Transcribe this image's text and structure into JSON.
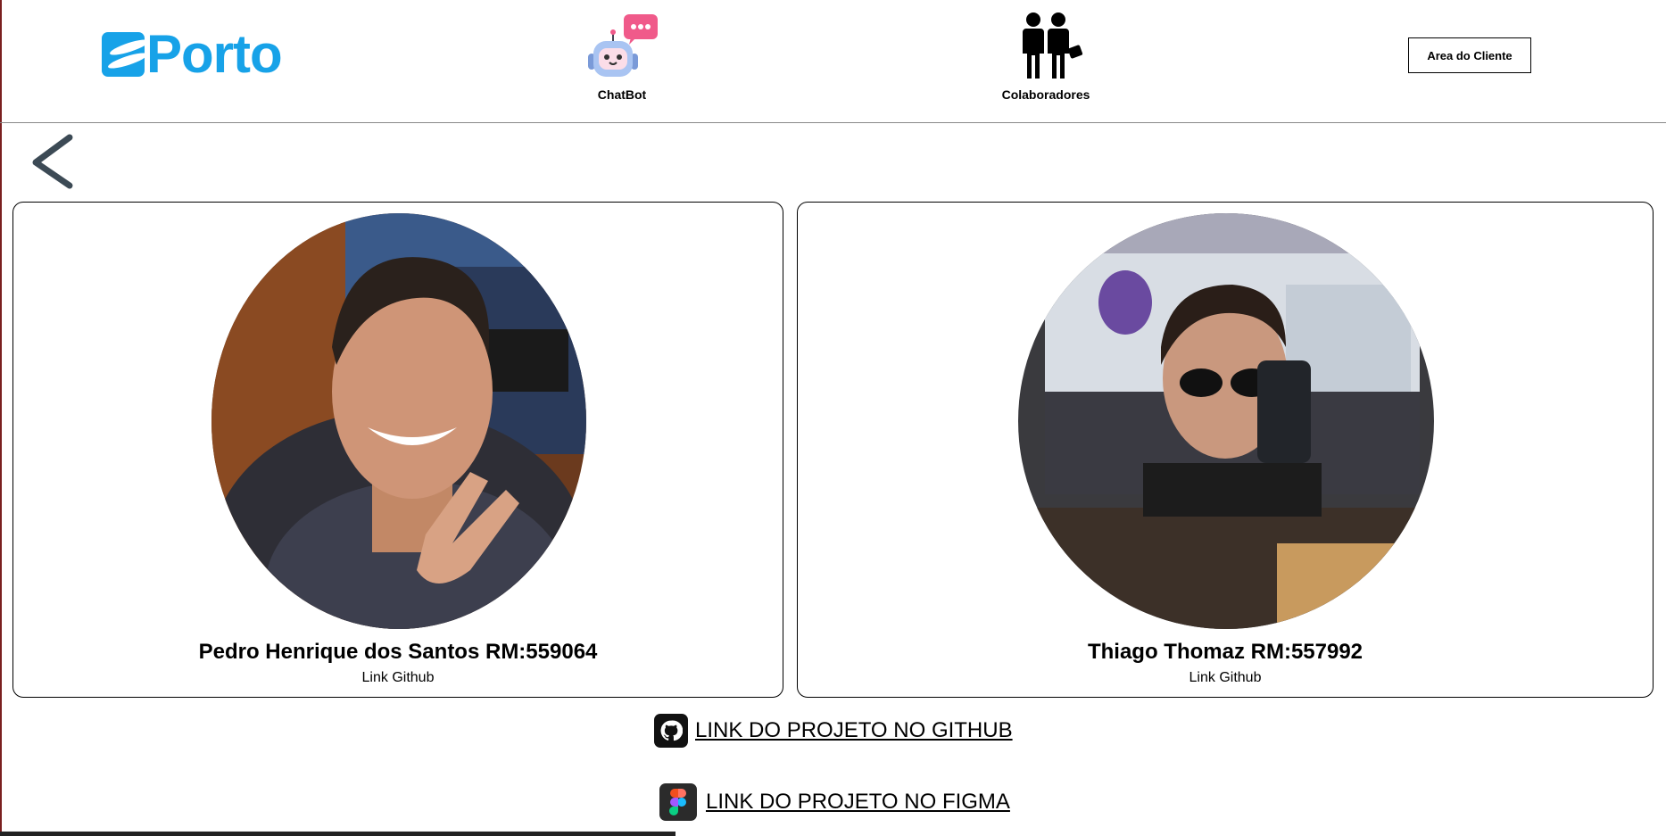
{
  "header": {
    "logo_text": "Porto",
    "nav": [
      {
        "label": "ChatBot",
        "icon": "robot-chat-icon"
      },
      {
        "label": "Colaboradores",
        "icon": "people-icon"
      }
    ],
    "client_button": "Area do Cliente"
  },
  "back_icon": "chevron-left-icon",
  "collaborators": [
    {
      "name": "Pedro Henrique dos Santos RM:559064",
      "link": "Link Github"
    },
    {
      "name": "Thiago Thomaz RM:557992",
      "link": "Link Github"
    }
  ],
  "project_links": {
    "github": {
      "label": "LINK DO PROJETO NO GITHUB",
      "icon": "github-icon"
    },
    "figma": {
      "label": "LINK DO PROJETO NO FIGMA",
      "icon": "figma-icon"
    }
  },
  "colors": {
    "brand": "#17a2e8",
    "border": "#000000"
  }
}
